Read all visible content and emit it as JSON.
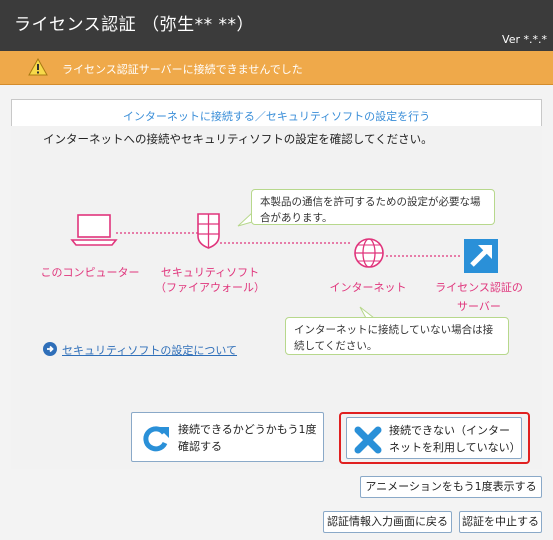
{
  "window": {
    "title": "ライセンス認証 （弥生** **）",
    "version": "Ver *.*.*"
  },
  "warning": {
    "icon": "warning-icon",
    "text": "ライセンス認証サーバーに接続できませんでした"
  },
  "main": {
    "heading": "インターネットに接続する／セキュリティソフトの設定を行う",
    "description": "インターネットへの接続やセキュリティソフトの設定を確認してください。",
    "bubble_security": "本製品の通信を許可するための設定が必要な場合があります。",
    "bubble_internet": "インターネットに接続していない場合は接続してください。",
    "nodes": {
      "computer": "このコンピューター",
      "security_line1": "セキュリティソフト",
      "security_line2": "（ファイアウォール）",
      "internet": "インターネット",
      "server_line1": "ライセンス認証の",
      "server_line2": "サーバー"
    },
    "security_link": "セキュリティソフトの設定について"
  },
  "buttons": {
    "retry_line1": "接続できるかどうかもう1度",
    "retry_line2": "確認する",
    "cannot_line1": "接続できない（インター",
    "cannot_line2": "ネットを利用していない）",
    "animation": "アニメーションをもう1度表示する",
    "back": "認証情報入力画面に戻る",
    "stop": "認証を中止する"
  },
  "colors": {
    "accent_pink": "#e0357c",
    "accent_blue": "#3a8ed8",
    "warning_bar": "#efa94a",
    "highlight_red": "#e02020"
  }
}
